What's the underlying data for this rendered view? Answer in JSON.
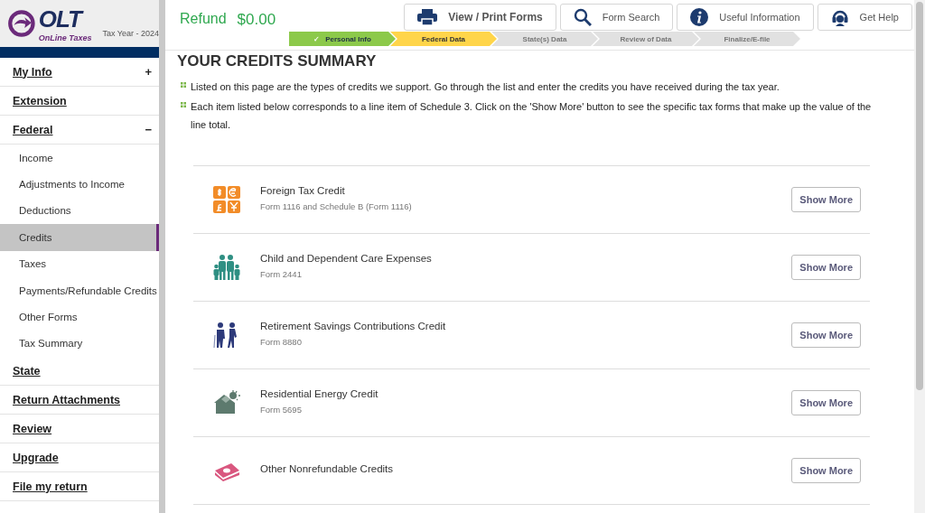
{
  "logo": {
    "mark": "OLT",
    "tagline": "OnLine Taxes",
    "tax_year": "Tax Year - 2024"
  },
  "refund": {
    "label": "Refund",
    "amount": "$0.00"
  },
  "toolbar": [
    {
      "label": "View / Print Forms",
      "kind": "print",
      "primary": true
    },
    {
      "label": "Form Search",
      "kind": "search",
      "primary": false
    },
    {
      "label": "Useful Information",
      "kind": "info",
      "primary": false
    },
    {
      "label": "Get Help",
      "kind": "help",
      "primary": false
    }
  ],
  "progress": [
    {
      "label": "Personal Info",
      "completed": true,
      "selected": false,
      "check": "✓"
    },
    {
      "label": "Federal Data",
      "completed": false,
      "selected": true
    },
    {
      "label": "State(s) Data",
      "completed": false,
      "selected": false
    },
    {
      "label": "Review of Data",
      "completed": false,
      "selected": false
    },
    {
      "label": "Finalize/E-file",
      "completed": false,
      "selected": false
    }
  ],
  "sidebar": {
    "items": [
      {
        "label": "My Info",
        "toggle": "+"
      },
      {
        "label": "Extension"
      },
      {
        "label": "Federal",
        "toggle": "−",
        "children": [
          {
            "label": "Income",
            "selected": false
          },
          {
            "label": "Adjustments to Income",
            "selected": false
          },
          {
            "label": "Deductions",
            "selected": false
          },
          {
            "label": "Credits",
            "selected": true
          },
          {
            "label": "Taxes",
            "selected": false
          },
          {
            "label": "Payments/Refundable Credits",
            "selected": false
          },
          {
            "label": "Other Forms",
            "selected": false
          },
          {
            "label": "Tax Summary",
            "selected": false
          }
        ]
      },
      {
        "label": "State"
      },
      {
        "label": "Return Attachments"
      },
      {
        "label": "Review"
      },
      {
        "label": "Upgrade"
      },
      {
        "label": "File my return"
      }
    ]
  },
  "title": "YOUR CREDITS SUMMARY",
  "notes": [
    "Listed on this page are the types of credits we support. Go through the list and enter the credits you have received during the tax year.",
    "Each item listed below corresponds to a line item of Schedule 3. Click on the 'Show More' button to see the specific tax forms that make up the value of the line total."
  ],
  "credits": [
    {
      "name": "Foreign Tax Credit",
      "forms": "Form 1116 and Schedule B (Form 1116)",
      "kind": "currency",
      "button": "Show More"
    },
    {
      "name": "Child and Dependent Care Expenses",
      "forms": "Form 2441",
      "kind": "family",
      "button": "Show More"
    },
    {
      "name": "Retirement Savings Contributions Credit",
      "forms": "Form 8880",
      "kind": "elderly",
      "button": "Show More"
    },
    {
      "name": "Residential Energy Credit",
      "forms": "Form 5695",
      "kind": "solar-house",
      "button": "Show More"
    },
    {
      "name": "Other Nonrefundable Credits",
      "kind": "cash",
      "button": "Show More"
    }
  ]
}
